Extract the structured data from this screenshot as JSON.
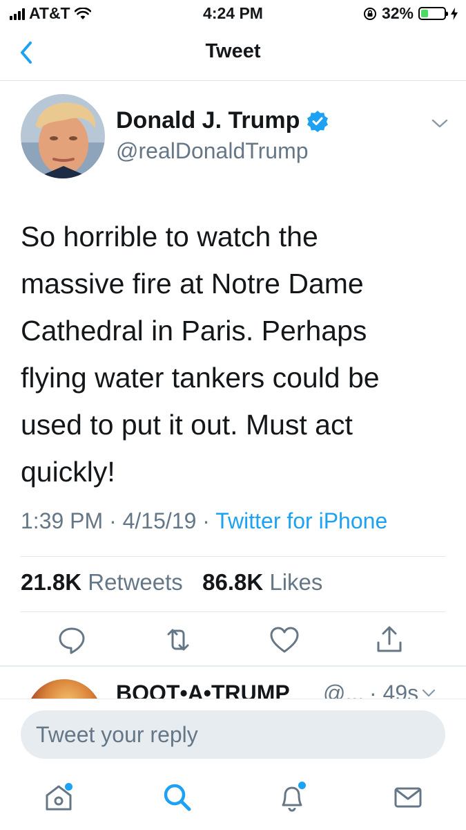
{
  "status_bar": {
    "carrier": "AT&T",
    "time": "4:24 PM",
    "battery_percent": "32%",
    "battery_level": 0.32
  },
  "nav": {
    "title": "Tweet",
    "back_icon": "chevron-left-icon"
  },
  "tweet": {
    "author_name": "Donald J. Trump",
    "author_handle": "@realDonaldTrump",
    "verified": true,
    "text": "So horrible to watch the\nmassive fire at Notre Dame\nCathedral in Paris. Perhaps\nflying water tankers could be\nused to put it out. Must act\nquickly!",
    "timestamp": "1:39 PM · 4/15/19 · ",
    "source": "Twitter for iPhone",
    "retweets_count": "21.8K",
    "retweets_label": "Retweets",
    "likes_count": "86.8K",
    "likes_label": "Likes"
  },
  "actions": [
    "reply-icon",
    "retweet-icon",
    "like-icon",
    "share-icon"
  ],
  "reply_preview": {
    "name": "BOOT•A•TRUMP",
    "handle": "@...",
    "time": "· 49s"
  },
  "composer": {
    "placeholder": "Tweet your reply"
  },
  "tab_bar": [
    "home-icon",
    "search-icon",
    "notifications-icon",
    "messages-icon"
  ],
  "colors": {
    "accent": "#1da1f2",
    "text_secondary": "#657786",
    "divider": "#e1e8ed",
    "battery": "#4cd964"
  }
}
